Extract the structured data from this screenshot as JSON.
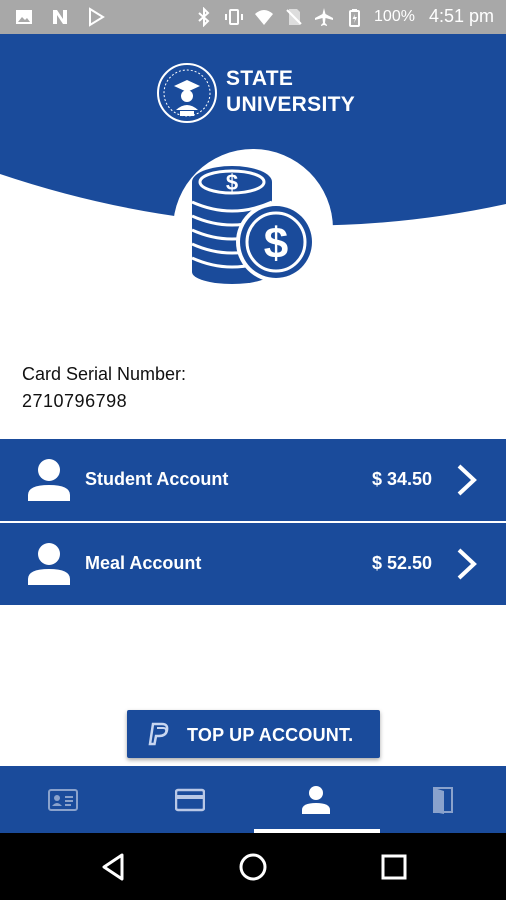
{
  "status_bar": {
    "left_icons": [
      "image-icon",
      "n-app-icon",
      "play-store-icon"
    ],
    "right_icons": [
      "bluetooth-icon",
      "vibrate-icon",
      "wifi-icon",
      "no-sim-icon",
      "airplane-icon",
      "battery-icon"
    ],
    "battery_text": "100%",
    "time": "4:51 pm"
  },
  "header": {
    "brand_line1": "STATE",
    "brand_line2": "UNIVERSITY",
    "logo_icon": "university-seal-icon",
    "hero_icon": "dollar-coins-icon"
  },
  "card": {
    "serial_label": "Card Serial Number:",
    "serial_number": "2710796798"
  },
  "accounts": [
    {
      "name": "Student Account",
      "amount": "$ 34.50",
      "icon": "person-icon"
    },
    {
      "name": "Meal Account",
      "amount": "$ 52.50",
      "icon": "person-icon"
    }
  ],
  "topup": {
    "label": "TOP UP ACCOUNT.",
    "icon": "paypal-icon"
  },
  "bottom_nav": {
    "tabs": [
      {
        "icon": "id-card-icon",
        "active": false
      },
      {
        "icon": "credit-card-icon",
        "active": false
      },
      {
        "icon": "person-icon",
        "active": true
      },
      {
        "icon": "door-icon",
        "active": false
      }
    ]
  },
  "system_nav": [
    "back-icon",
    "home-icon",
    "recents-icon"
  ],
  "colors": {
    "primary": "#1a4b9b",
    "status_bar": "#a8a8a8",
    "system_nav": "#000000",
    "text": "#111111"
  }
}
